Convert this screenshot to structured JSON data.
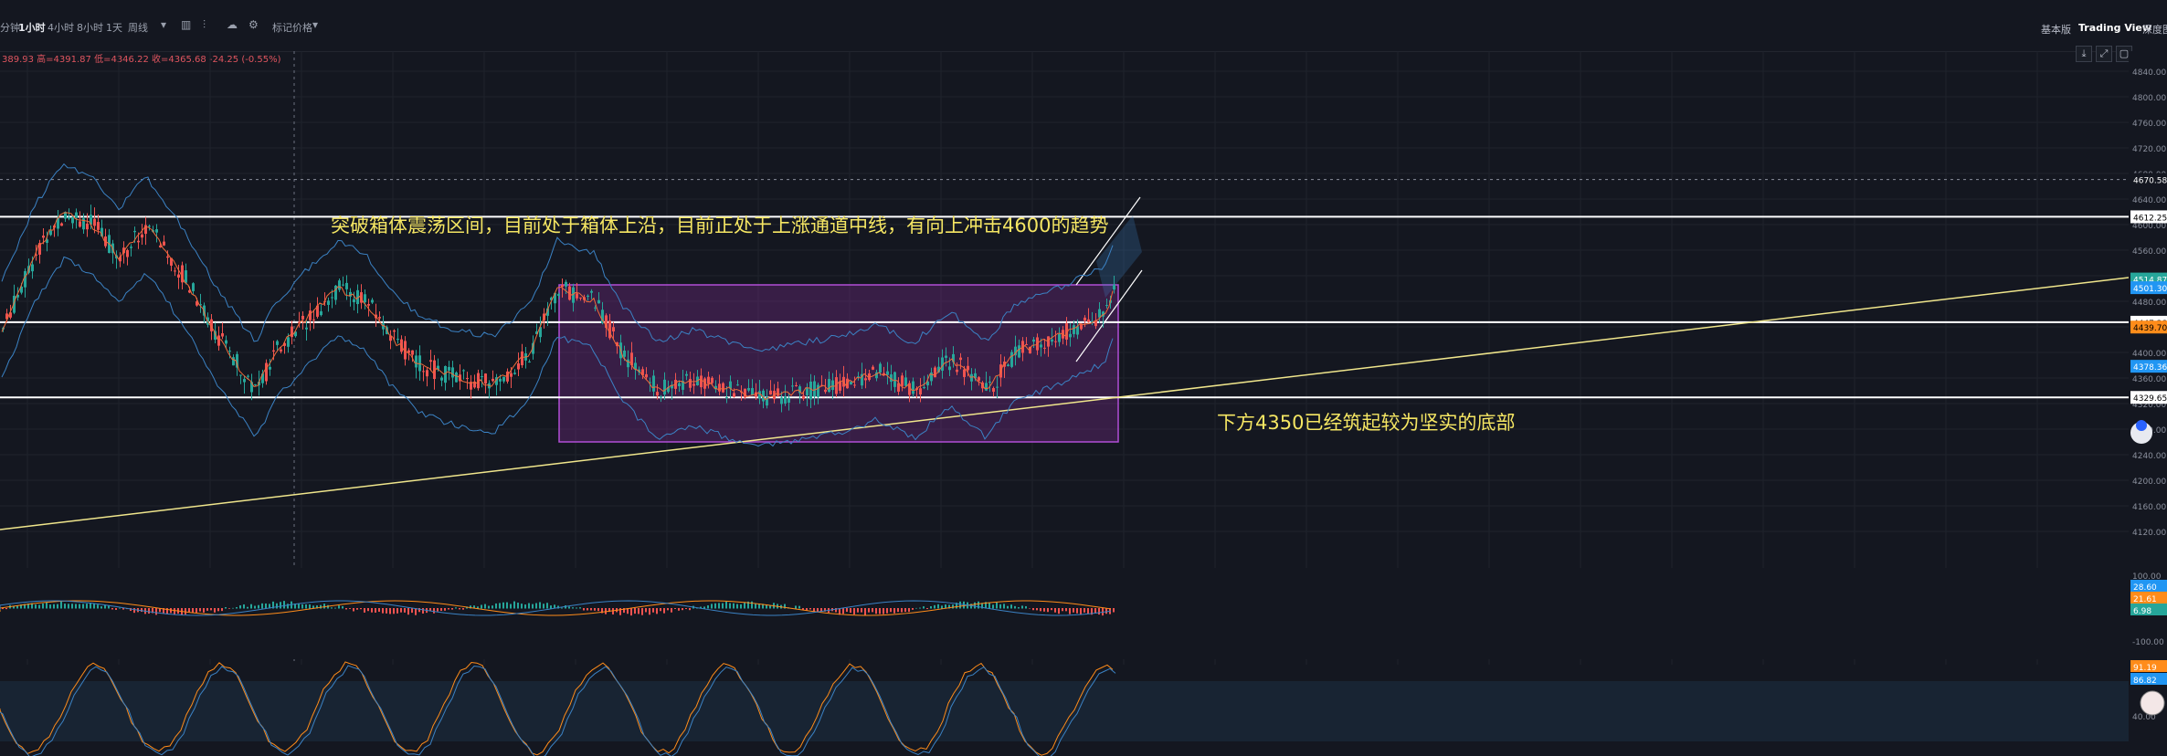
{
  "toolbar": {
    "intervals": [
      {
        "label": "分钟",
        "active": false
      },
      {
        "label": "1小时",
        "active": true
      },
      {
        "label": "4小时",
        "active": false
      },
      {
        "label": "8小时",
        "active": false
      },
      {
        "label": "1天",
        "active": false
      },
      {
        "label": "周线",
        "active": false
      }
    ],
    "dropdown_icon": "▾",
    "indicator_label": "标记价格",
    "right_items": [
      "基本版",
      "Trading View",
      "深度图"
    ]
  },
  "ohlc_text": "389.93 高=4391.87 低=4346.22 收=4365.68 -24.25 (-0.55%)",
  "annotations": {
    "upper_text": "突破箱体震荡区间，目前处于箱体上沿，目前正处于上涨通道中线，有向上冲击4600的趋势",
    "lower_text": "下方4350已经筑起较为坚实的底部"
  },
  "price_axis": {
    "ticks": [
      "4840.00",
      "4800.00",
      "4760.00",
      "4720.00",
      "4680.00",
      "4640.00",
      "4600.00",
      "4560.00",
      "4520.00",
      "4480.00",
      "4440.00",
      "4400.00",
      "4360.00",
      "4320.00",
      "4280.00",
      "4240.00",
      "4200.00",
      "4160.00",
      "4120.00"
    ],
    "labels": [
      {
        "text": "4670.58",
        "color": "#141720",
        "fg": "#ffffff"
      },
      {
        "text": "4612.25",
        "color": "#ffffff",
        "fg": "#000000"
      },
      {
        "text": "4514.87",
        "color": "#26a69a",
        "fg": "#ffffff"
      },
      {
        "text": "4501.30",
        "color": "#2196f3",
        "fg": "#ffffff"
      },
      {
        "text": "4447.28",
        "color": "#ffffff",
        "fg": "#000000"
      },
      {
        "text": "4439.70",
        "color": "#ff8c1a",
        "fg": "#000000"
      },
      {
        "text": "4378.36",
        "color": "#2196f3",
        "fg": "#ffffff"
      },
      {
        "text": "4329.65",
        "color": "#ffffff",
        "fg": "#000000"
      }
    ]
  },
  "macd_axis": {
    "ticks": [
      "100.00",
      "-100.00"
    ],
    "labels": [
      {
        "text": "28.60",
        "color": "#2196f3"
      },
      {
        "text": "21.61",
        "color": "#ff8c1a"
      },
      {
        "text": "6.98",
        "color": "#26a69a"
      }
    ]
  },
  "stoch_axis": {
    "ticks": [
      "40.00"
    ],
    "labels": [
      {
        "text": "91.19",
        "color": "#ff8c1a"
      },
      {
        "text": "86.82",
        "color": "#2196f3"
      }
    ]
  },
  "colors": {
    "accent_text": "#f5e663",
    "trendline": "#f0e68c",
    "box": "#b14fd6",
    "band": "#3b82c4",
    "up": "#26a69a",
    "down": "#ef5350"
  }
}
